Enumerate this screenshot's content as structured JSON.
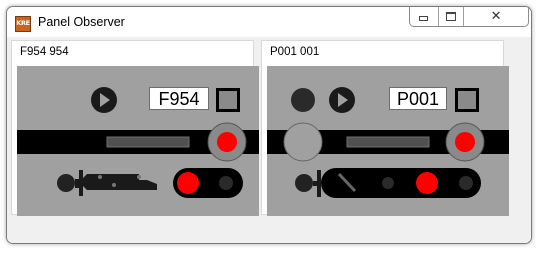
{
  "window": {
    "title": "Panel Observer",
    "icon": "app-logo-icon",
    "icon_text": "KRE"
  },
  "caption_buttons": {
    "minimize": "minimize-icon",
    "maximize": "maximize-icon",
    "close": "close-icon",
    "close_glyph": "✕"
  },
  "panels": [
    {
      "title": "F954 954",
      "name_box": "F954",
      "signal_lamp_color": "#ff0000",
      "left_lamp_color": "#ff0000"
    },
    {
      "title": "P001 001",
      "name_box": "P001",
      "signal_lamp_color": "#ff0000",
      "left_lamp_color": "#ff0000"
    }
  ],
  "colors": {
    "panel_bg": "#a0a0a0",
    "track": "#000000",
    "lamp_on": "#ff0000",
    "lamp_off": "#222222"
  }
}
